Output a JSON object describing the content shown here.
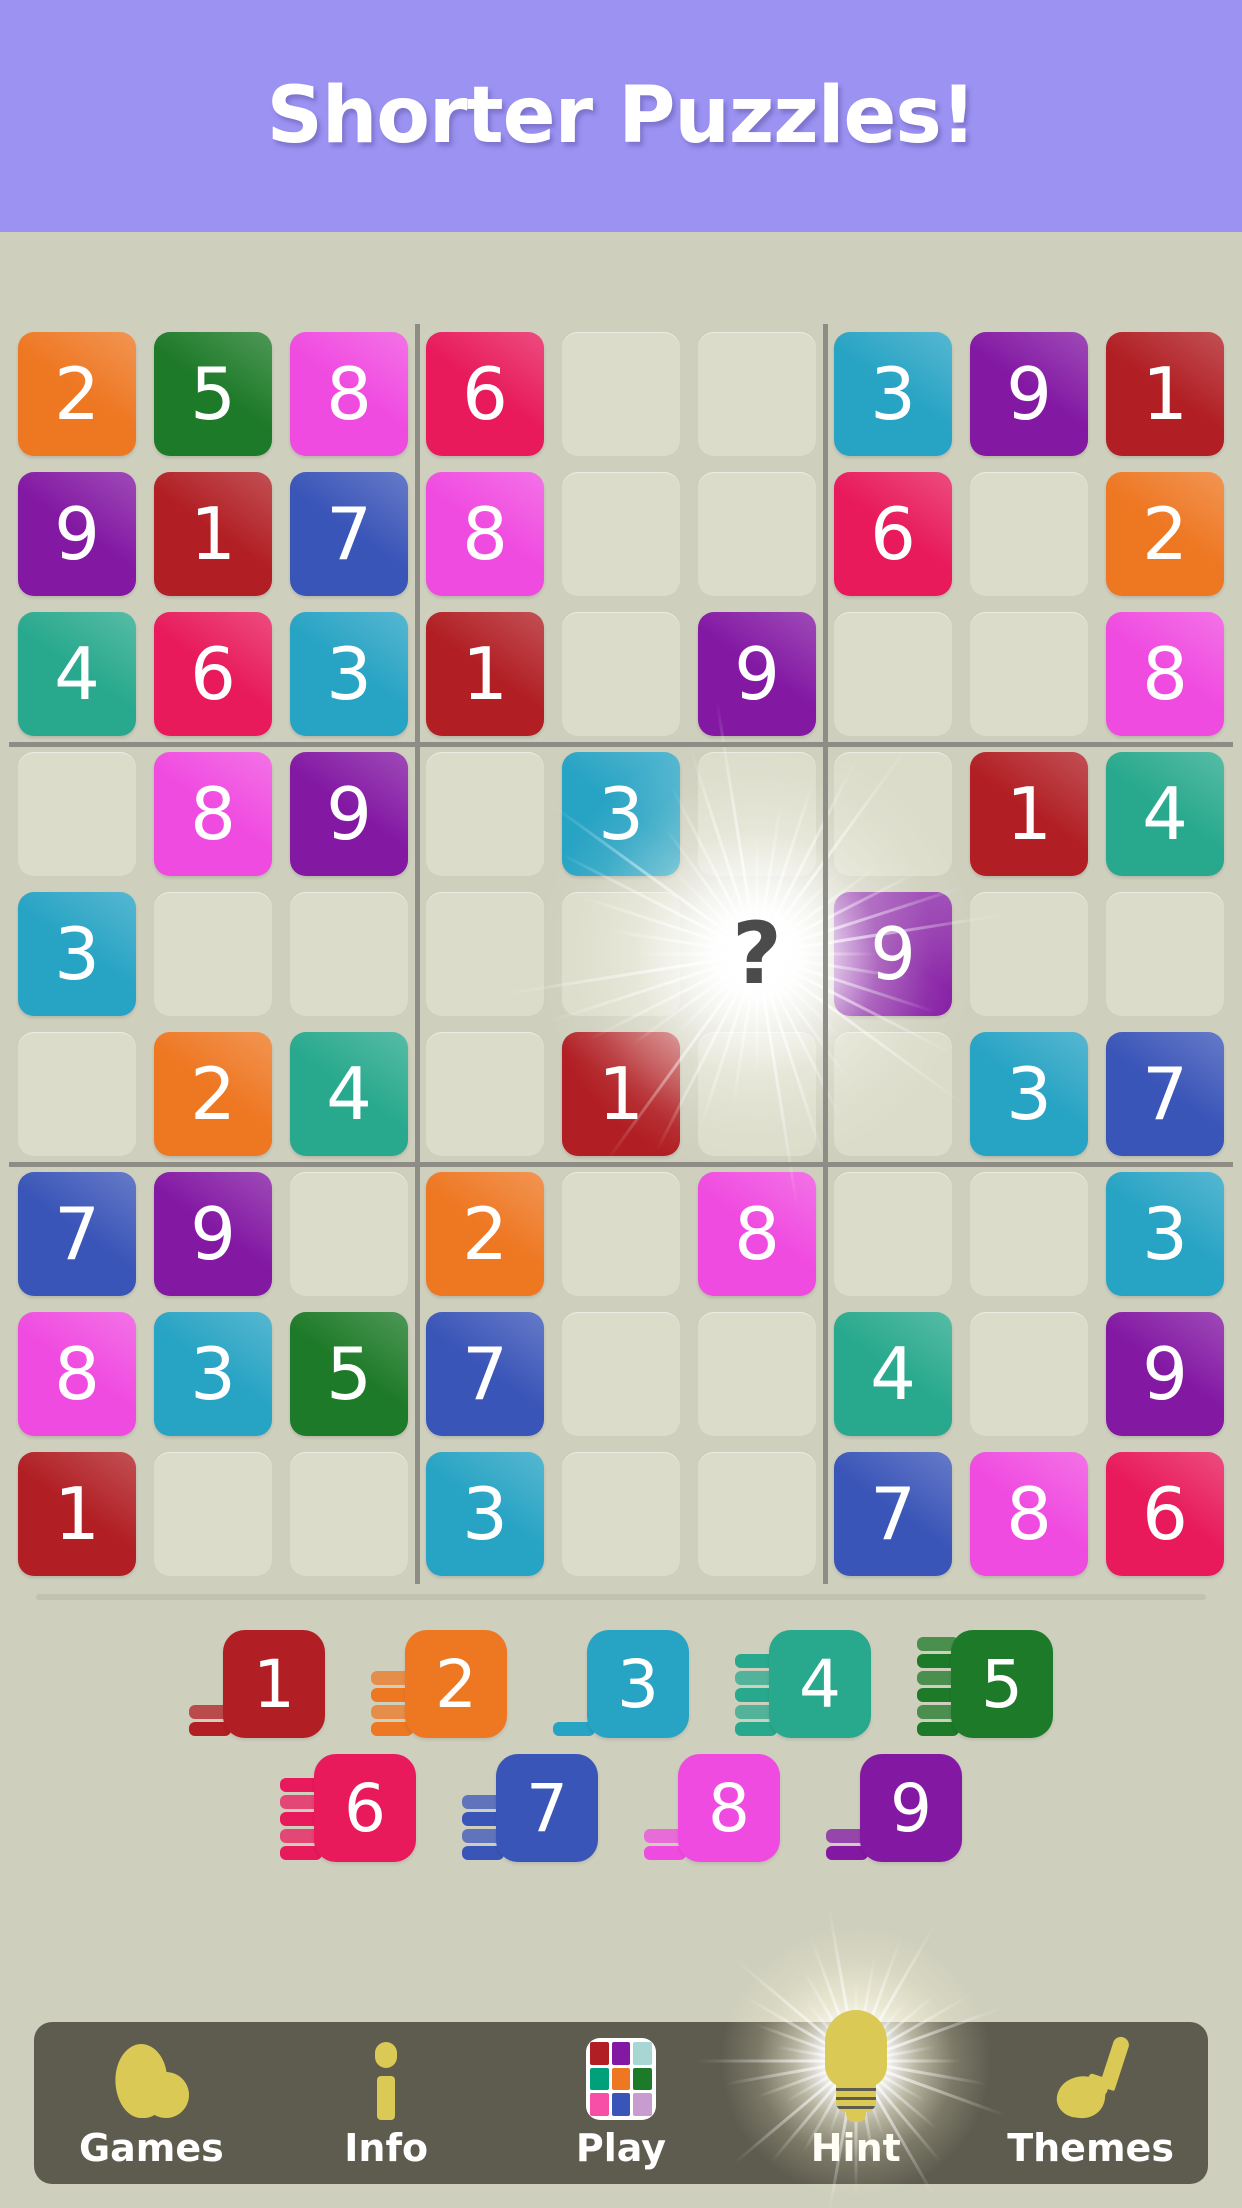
{
  "banner": {
    "title": "Shorter Puzzles!"
  },
  "colors": {
    "background": "#cfcfbe",
    "banner_bg": "#9b92f2",
    "empty_cell": "#dcdccb",
    "block_line": "#8d8d85",
    "navbar_bg": "#5e5c4f",
    "nav_icon": "#dac955",
    "digit_1": "#b11f24",
    "digit_2": "#ee7722",
    "digit_3": "#27a3c4",
    "digit_4": "#28a98d",
    "digit_5": "#1d7a28",
    "digit_6": "#e81a5c",
    "digit_7": "#3a55b8",
    "digit_8": "#f04be0",
    "digit_9": "#8318a3"
  },
  "board": {
    "rows": [
      [
        "2",
        "5",
        "8",
        "6",
        "",
        "",
        "3",
        "9",
        "1"
      ],
      [
        "9",
        "1",
        "7",
        "8",
        "",
        "",
        "6",
        "",
        "2"
      ],
      [
        "4",
        "6",
        "3",
        "1",
        "",
        "9",
        "",
        "",
        "8"
      ],
      [
        "",
        "8",
        "9",
        "",
        "3",
        "",
        "",
        "1",
        "4"
      ],
      [
        "3",
        "",
        "",
        "",
        "",
        "?",
        "9",
        "",
        ""
      ],
      [
        "",
        "2",
        "4",
        "",
        "1",
        "",
        "",
        "3",
        "7"
      ],
      [
        "7",
        "9",
        "",
        "2",
        "",
        "8",
        "",
        "",
        "3"
      ],
      [
        "8",
        "3",
        "5",
        "7",
        "",
        "",
        "4",
        "",
        "9"
      ],
      [
        "1",
        "",
        "",
        "3",
        "",
        "",
        "7",
        "8",
        "6"
      ]
    ],
    "hint_cell": {
      "row": 4,
      "col": 5,
      "label": "?"
    }
  },
  "numberpad": {
    "row1": [
      {
        "digit": "1",
        "remaining": 2
      },
      {
        "digit": "2",
        "remaining": 4
      },
      {
        "digit": "3",
        "remaining": 1
      },
      {
        "digit": "4",
        "remaining": 5
      },
      {
        "digit": "5",
        "remaining": 6
      }
    ],
    "row2": [
      {
        "digit": "6",
        "remaining": 5
      },
      {
        "digit": "7",
        "remaining": 4
      },
      {
        "digit": "8",
        "remaining": 2
      },
      {
        "digit": "9",
        "remaining": 2
      }
    ]
  },
  "navbar": {
    "items": [
      {
        "label": "Games",
        "icon": "games-icon"
      },
      {
        "label": "Info",
        "icon": "info-icon"
      },
      {
        "label": "Play",
        "icon": "play-grid-icon"
      },
      {
        "label": "Hint",
        "icon": "lightbulb-icon"
      },
      {
        "label": "Themes",
        "icon": "paintbrush-icon"
      }
    ],
    "play_icon_colors": [
      "#b11f24",
      "#8318a3",
      "#a8d6d2",
      "#00a07a",
      "#ee7722",
      "#1d7a28",
      "#f74fa8",
      "#3a55b8",
      "#c89cd0"
    ]
  }
}
